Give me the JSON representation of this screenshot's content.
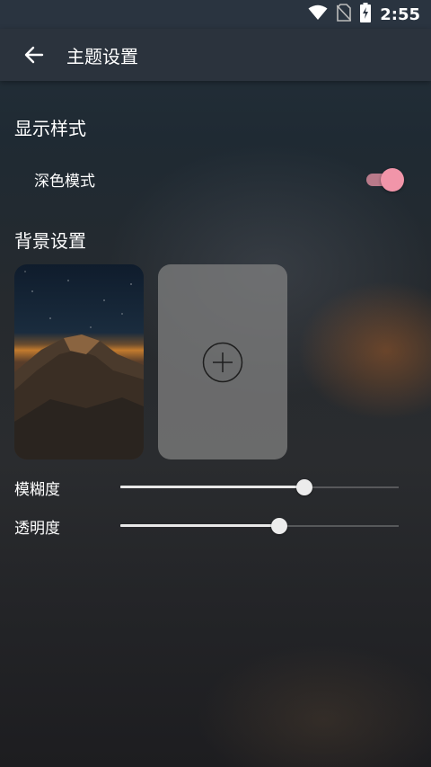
{
  "status_bar": {
    "time": "2:55",
    "icons": [
      "wifi-icon",
      "no-sim-icon",
      "battery-charging-icon"
    ]
  },
  "app_bar": {
    "title": "主题设置",
    "back_icon": "arrow-left-icon"
  },
  "display_section": {
    "title": "显示样式",
    "dark_mode": {
      "label": "深色模式",
      "enabled": true,
      "accent_color": "#f195a9"
    }
  },
  "background_section": {
    "title": "背景设置",
    "thumbnail": "mountain-night-sky-image",
    "add_icon": "plus-circle-icon"
  },
  "sliders": [
    {
      "label": "模糊度",
      "value": 0.66
    },
    {
      "label": "透明度",
      "value": 0.57
    }
  ]
}
